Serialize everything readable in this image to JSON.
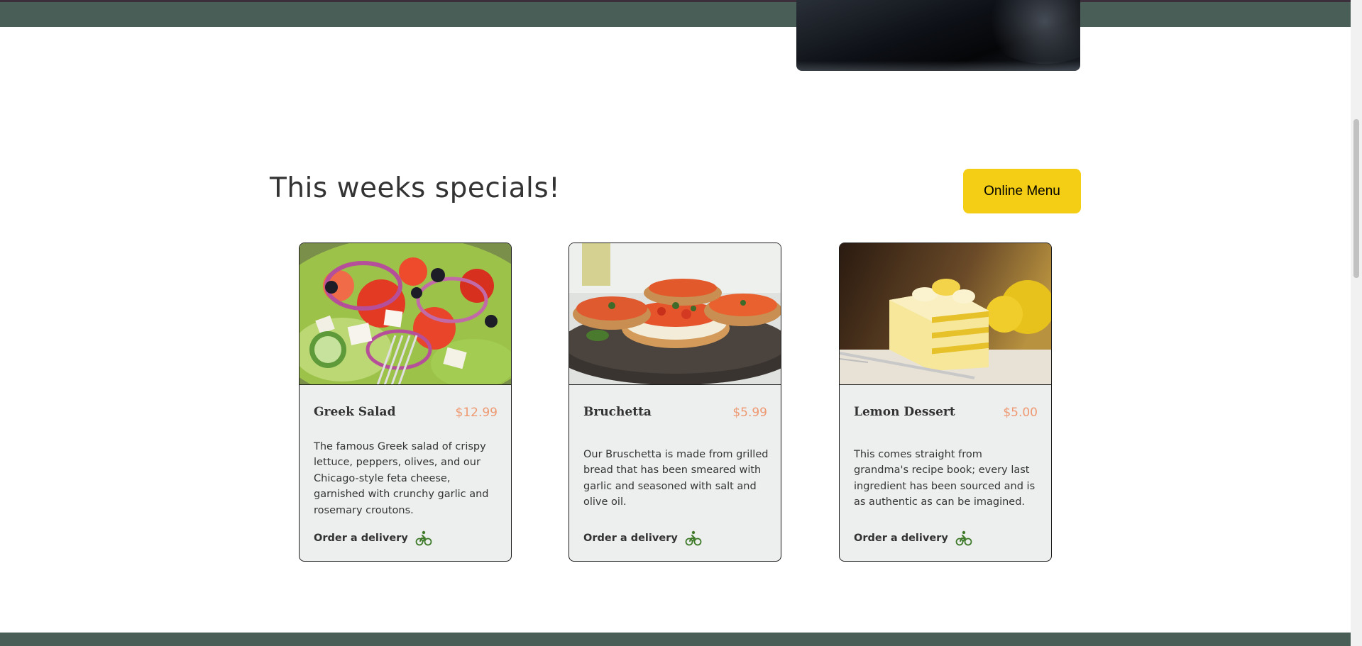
{
  "specials": {
    "title": "This weeks specials!",
    "online_menu_label": "Online Menu"
  },
  "cards": [
    {
      "title": "Greek Salad",
      "price": "$12.99",
      "description": "The famous Greek salad of crispy lettuce, peppers, olives, and our Chicago-style feta cheese, garnished with crunchy garlic and rosemary croutons.",
      "order_label": "Order a delivery",
      "image_icon": "greek-salad-image"
    },
    {
      "title": "Bruchetta",
      "price": "$5.99",
      "description": "Our Bruschetta is made from grilled bread that has been smeared with garlic and seasoned with salt and olive oil.",
      "order_label": "Order a delivery",
      "image_icon": "bruchetta-image"
    },
    {
      "title": "Lemon Dessert",
      "price": "$5.00",
      "description": "This comes straight from grandma's recipe book; every last ingredient has been sourced and is as authentic as can be imagined.",
      "order_label": "Order a delivery",
      "image_icon": "lemon-dessert-image"
    }
  ],
  "colors": {
    "primary_green": "#495e57",
    "primary_yellow": "#f4ce14",
    "price_salmon": "#ee9972",
    "card_bg": "#edefee",
    "icon_green": "#3f7b2a"
  }
}
